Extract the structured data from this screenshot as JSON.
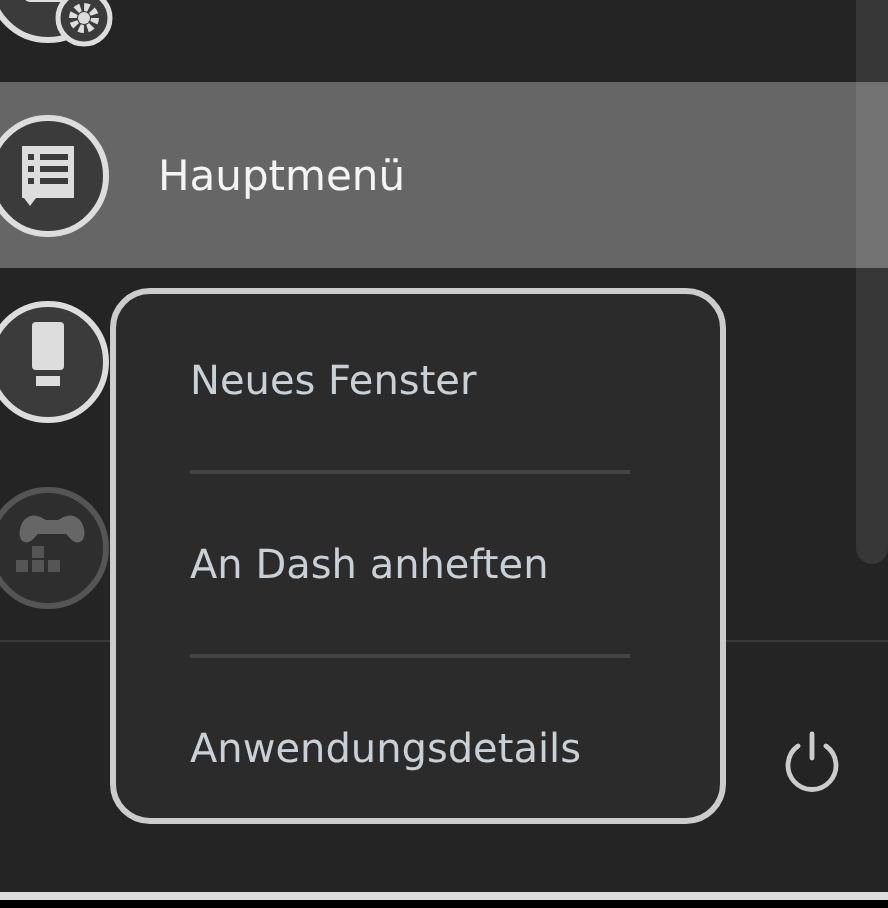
{
  "app_list": [
    {
      "kind": "settings",
      "selected": false
    },
    {
      "kind": "menu",
      "label": "Hauptmenü",
      "selected": true
    },
    {
      "kind": "drive",
      "selected": false
    },
    {
      "kind": "game",
      "selected": false
    }
  ],
  "context_menu": {
    "items": [
      "Neues Fenster",
      "An Dash anheften",
      "Anwendungsdetails"
    ]
  }
}
